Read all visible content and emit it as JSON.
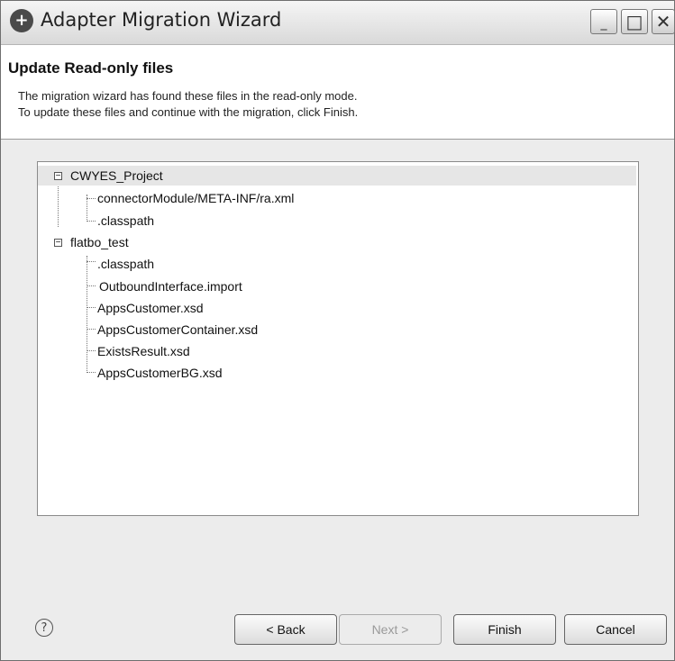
{
  "window": {
    "title": "Adapter Migration Wizard"
  },
  "header": {
    "heading": "Update Read-only files",
    "description_line1": "The migration wizard has found these files in the read-only mode.",
    "description_line2": "To update these files and continue with the migration, click Finish."
  },
  "tree": {
    "nodes": [
      {
        "label": "CWYES_Project",
        "expanded_symbol": "−"
      },
      {
        "label": "connectorModule/META-INF/ra.xml"
      },
      {
        "label": ".classpath"
      },
      {
        "label": "flatbo_test",
        "expanded_symbol": "−"
      },
      {
        "label": ".classpath"
      },
      {
        "label": "OutboundInterface.import"
      },
      {
        "label": "AppsCustomer.xsd"
      },
      {
        "label": "AppsCustomerContainer.xsd"
      },
      {
        "label": "ExistsResult.xsd"
      },
      {
        "label": "AppsCustomerBG.xsd"
      }
    ]
  },
  "buttons": {
    "help": "?",
    "back": "< Back",
    "next": "Next >",
    "finish": "Finish",
    "cancel": "Cancel"
  }
}
